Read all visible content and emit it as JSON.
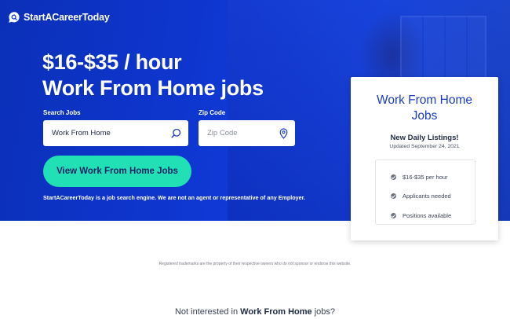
{
  "brand": {
    "name": "StartACareerToday"
  },
  "hero": {
    "headline_line1": "$16-$35 / hour",
    "headline_line2": "Work From Home jobs",
    "search_label": "Search Jobs",
    "search_value": "Work From Home",
    "zip_label": "Zip Code",
    "zip_placeholder": "Zip Code",
    "cta_label": "View Work From Home Jobs",
    "disclaimer": "StartACareerToday is a job search engine. We are not an agent or representative of any Employer."
  },
  "card": {
    "title_line1": "Work From Home",
    "title_line2": "Jobs",
    "subtitle": "New Daily Listings!",
    "updated": "Updated September 24, 2021",
    "features": [
      "$16-$35 per hour",
      "Applicants needed",
      "Positions available"
    ]
  },
  "footer": {
    "trademark": "Registered trademarks are the property of their respective owners who do not sponsor or endorse this website.",
    "not_interested_prefix": "Not interested in",
    "not_interested_bold": "Work From Home",
    "not_interested_suffix": "jobs?"
  },
  "colors": {
    "hero_blue": "#0f38d4",
    "cta_green": "#22e0b5",
    "card_title_blue": "#1a3bc7"
  },
  "icons": {
    "logo": "chat-bubble-search-icon",
    "search": "search-icon",
    "zip": "map-pin-icon",
    "feature_bullet": "check-circle-icon"
  }
}
